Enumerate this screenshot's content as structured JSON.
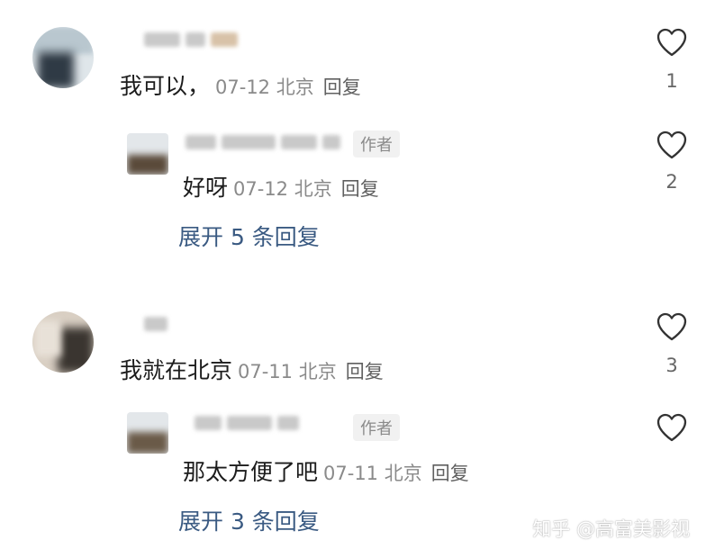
{
  "comments": [
    {
      "text": "我可以，",
      "date": "07-12",
      "location": "北京",
      "reply_label": "回复",
      "likes": "1",
      "reply": {
        "author_tag": "作者",
        "text": "好呀",
        "date": "07-12",
        "location": "北京",
        "reply_label": "回复",
        "likes": "2"
      },
      "expand_label": "展开 5 条回复"
    },
    {
      "text": "我就在北京",
      "date": "07-11",
      "location": "北京",
      "reply_label": "回复",
      "likes": "3",
      "reply": {
        "author_tag": "作者",
        "text": "那太方便了吧",
        "date": "07-11",
        "location": "北京",
        "reply_label": "回复",
        "likes": ""
      },
      "expand_label": "展开 3 条回复"
    }
  ],
  "watermark": "知乎 @高富美影视",
  "icons": {
    "like": "heart-outline-icon"
  },
  "colors": {
    "link": "#3a5a82",
    "meta": "#8a8a8a",
    "text": "#1c1c1c"
  }
}
